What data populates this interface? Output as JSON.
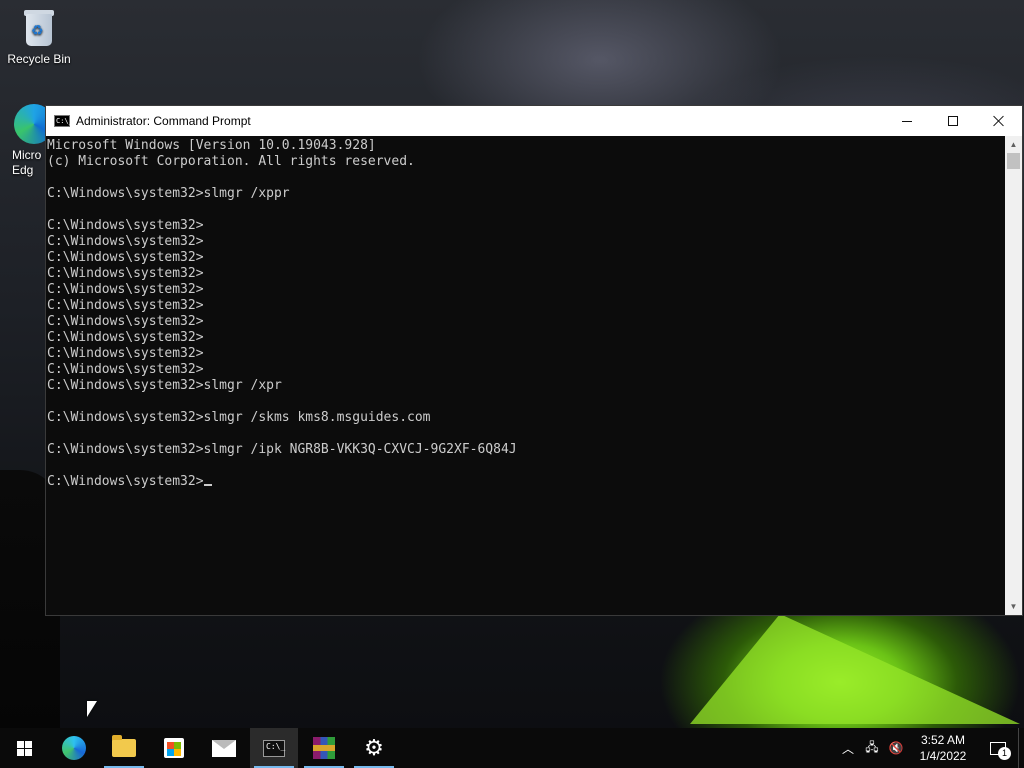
{
  "desktop": {
    "icons": [
      {
        "label": "Recycle Bin",
        "icon": "recycle-bin-icon"
      },
      {
        "label": "Micro\nEdg",
        "icon": "edge-icon"
      }
    ]
  },
  "window": {
    "title": "Administrator: Command Prompt",
    "icon": "cmd-icon",
    "controls": [
      "minimize",
      "maximize",
      "close"
    ]
  },
  "console": {
    "lines": [
      "Microsoft Windows [Version 10.0.19043.928]",
      "(c) Microsoft Corporation. All rights reserved.",
      "",
      "C:\\Windows\\system32>slmgr /xppr",
      "",
      "C:\\Windows\\system32>",
      "C:\\Windows\\system32>",
      "C:\\Windows\\system32>",
      "C:\\Windows\\system32>",
      "C:\\Windows\\system32>",
      "C:\\Windows\\system32>",
      "C:\\Windows\\system32>",
      "C:\\Windows\\system32>",
      "C:\\Windows\\system32>",
      "C:\\Windows\\system32>",
      "C:\\Windows\\system32>slmgr /xpr",
      "",
      "C:\\Windows\\system32>slmgr /skms kms8.msguides.com",
      "",
      "C:\\Windows\\system32>slmgr /ipk NGR8B-VKK3Q-CXVCJ-9G2XF-6Q84J",
      "",
      "C:\\Windows\\system32>"
    ],
    "text_color": "#cccccc",
    "background": "#0c0c0c"
  },
  "taskbar": {
    "apps": [
      {
        "name": "start",
        "icon": "windows-start-icon"
      },
      {
        "name": "edge",
        "icon": "edge-icon"
      },
      {
        "name": "file-explorer",
        "icon": "folder-icon",
        "running": true
      },
      {
        "name": "store",
        "icon": "store-icon"
      },
      {
        "name": "mail",
        "icon": "mail-icon"
      },
      {
        "name": "command-prompt",
        "icon": "cmd-icon",
        "active": true
      },
      {
        "name": "winrar",
        "icon": "winrar-icon",
        "running": true
      },
      {
        "name": "settings",
        "icon": "gear-icon",
        "running": true
      }
    ],
    "tray": {
      "time": "3:52 AM",
      "date": "1/4/2022",
      "notification_count": "1"
    },
    "accent": "#76b9ed"
  }
}
